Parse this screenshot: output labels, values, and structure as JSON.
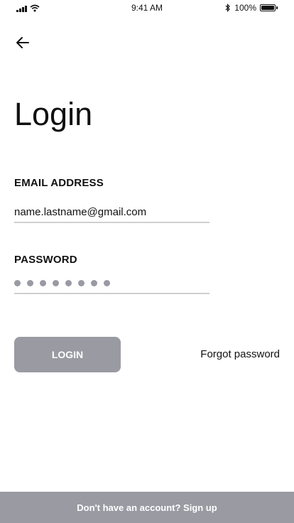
{
  "status_bar": {
    "time": "9:41 AM",
    "battery_text": "100%",
    "battery_level": 1.0,
    "icons": [
      "signal-icon",
      "wifi-icon",
      "bluetooth-icon",
      "battery-icon"
    ]
  },
  "header": {
    "back_icon": "arrow-left-icon"
  },
  "title": "Login",
  "form": {
    "email_label": "EMAIL ADDRESS",
    "email_value": "name.lastname@gmail.com",
    "password_label": "PASSWORD",
    "password_length": 8
  },
  "actions": {
    "login_label": "LOGIN",
    "forgot_label": "Forgot password"
  },
  "footer": {
    "signup_text": "Don't have an account? Sign up"
  },
  "colors": {
    "accent": "#9a9aa3",
    "divider": "#cfcfd2",
    "text": "#111111",
    "background": "#ffffff"
  }
}
